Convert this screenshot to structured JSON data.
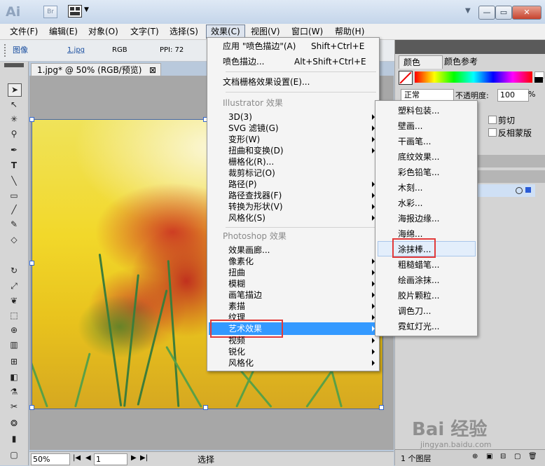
{
  "titlebar": {
    "logo": "Ai",
    "br": "Br",
    "dropdown": "▼",
    "min": "—",
    "max": "▭",
    "close": "✕"
  },
  "menubar": {
    "items": [
      "文件(F)",
      "编辑(E)",
      "对象(O)",
      "文字(T)",
      "选择(S)",
      "效果(C)",
      "视图(V)",
      "窗口(W)",
      "帮助(H)"
    ],
    "active_index": 5
  },
  "controlbar": {
    "label": "图像",
    "file": "1.jpg",
    "mode": "RGB",
    "ppi": "PPI: 72"
  },
  "document": {
    "tab_title": "1.jpg* @ 50% (RGB/预览)",
    "tab_close": "⊠"
  },
  "status": {
    "zoom": "50%",
    "page": "1",
    "tool": "选择"
  },
  "effect_menu": {
    "top": [
      {
        "label": "应用 \"喷色描边\"(A)",
        "shortcut": "Shift+Ctrl+E"
      },
      {
        "label": "喷色描边...",
        "shortcut": "Alt+Shift+Ctrl+E"
      }
    ],
    "doc_raster": "文档栅格效果设置(E)...",
    "illustrator_header": "Illustrator 效果",
    "illustrator_items": [
      "3D(3)",
      "SVG 滤镜(G)",
      "变形(W)",
      "扭曲和变换(D)",
      "栅格化(R)...",
      "裁剪标记(O)",
      "路径(P)",
      "路径查找器(F)",
      "转换为形状(V)",
      "风格化(S)"
    ],
    "illustrator_arrows": [
      true,
      true,
      true,
      true,
      false,
      false,
      true,
      true,
      true,
      true
    ],
    "photoshop_header": "Photoshop 效果",
    "photoshop_items": [
      "效果画廊...",
      "像素化",
      "扭曲",
      "模糊",
      "画笔描边",
      "素描",
      "纹理",
      "艺术效果",
      "视频",
      "锐化",
      "风格化"
    ],
    "photoshop_arrows": [
      false,
      true,
      true,
      true,
      true,
      true,
      true,
      true,
      true,
      true,
      true
    ],
    "highlight": "艺术效果"
  },
  "art_submenu": {
    "items": [
      "塑料包装...",
      "壁画...",
      "干画笔...",
      "底纹效果...",
      "彩色铅笔...",
      "木刻...",
      "水彩...",
      "海报边缘...",
      "海绵...",
      "涂抹棒...",
      "粗糙蜡笔...",
      "绘画涂抹...",
      "胶片颗粒...",
      "调色刀...",
      "霓虹灯光..."
    ],
    "hover": "涂抹棒..."
  },
  "color_panel": {
    "tab1": "颜色",
    "tab2": "颜色参考"
  },
  "transparency": {
    "blend": "正常",
    "opacity_label": "不透明度:",
    "opacity": "100",
    "pct": "%",
    "clip": "剪切",
    "invert": "反相蒙版"
  },
  "layers": {
    "count": "1 个图层"
  },
  "watermark": {
    "brand": "Bai 经验",
    "url": "jingyan.baidu.com"
  },
  "colors": {
    "highlight": "#3399ff",
    "redbox": "#e23a3a",
    "menu_bg": "#f4f4f4"
  }
}
